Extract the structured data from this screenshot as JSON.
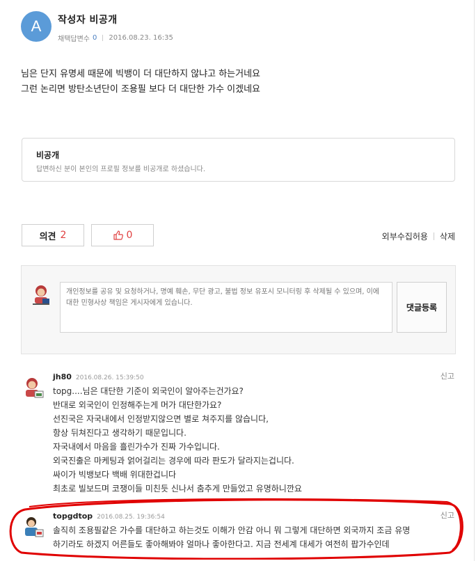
{
  "author": {
    "avatar_letter": "A",
    "name": "작성자 비공개",
    "adoption_label": "채택답변수",
    "adoption_count": "0",
    "datetime": "2016.08.23. 16:35"
  },
  "answer": {
    "lines": [
      "님은 단지 유명세 때문에 빅뱅이 더 대단하지 않냐고 하는거네요",
      "그런 논리면 방탄소년단이 조용필 보다 더 대단한 가수 이겠네요"
    ]
  },
  "private_notice": {
    "title": "비공개",
    "description": "답변하신 분이 본인의 프로필 정보를 비공개로 하셨습니다."
  },
  "actions": {
    "opinion_label": "의견",
    "opinion_count": "2",
    "like_count": "0",
    "collect_label": "외부수집허용",
    "delete_label": "삭제"
  },
  "comment_form": {
    "placeholder": "개인정보를 공유 및 요청하거나, 명예 훼손, 무단 광고, 불법 정보 유포시 모니터링 후 삭제될 수 있으며, 이에 대한 민형사상 책임은 게시자에게 있습니다.",
    "submit_label": "댓글등록"
  },
  "comments": [
    {
      "user": "jh80",
      "date": "2016.08.26. 15:39:50",
      "report_label": "신고",
      "lines": [
        "topg....님은 대단한 기준이 외국인이 알아주는건가요?",
        "반대로 외국인이 인정해주는게 머가 대단한가요?",
        "선진국은 자국내에서 인정받지않으면 별로 쳐주지를 않습니다,",
        "항상 뒤쳐진다고 생각하기 때문입니다.",
        "자국내에서 마음을 흘린가수가 진짜 가수입니다.",
        "외국진출은 마케팅과 얽어걸리는 경우에 따라 판도가 달라지는겁니다.",
        "싸이가 빅뱅보다 백배 위대한겁니다",
        "최초로 빌보드며 코쟁이들 미친듯 신나서 춤추게 만들었고 유명하니깐요"
      ]
    },
    {
      "user": "topgdtop",
      "date": "2016.08.25. 19:36:54",
      "report_label": "신고",
      "lines": [
        "솔직히 조용필같은 가수를 대단하고 하는것도 이해가 안감 아니 뭐 그렇게 대단하면 외국까지 조금 유명",
        "하기라도 하겠지 어른들도 좋아해봐야 얼마나 좋아한다고. 지금 전세계 대세가 여전히 팝가수인데"
      ]
    }
  ],
  "colors": {
    "avatar_bg": "#5b9bd8",
    "accent_red": "#e04040",
    "highlight_ellipse": "#e00000"
  }
}
